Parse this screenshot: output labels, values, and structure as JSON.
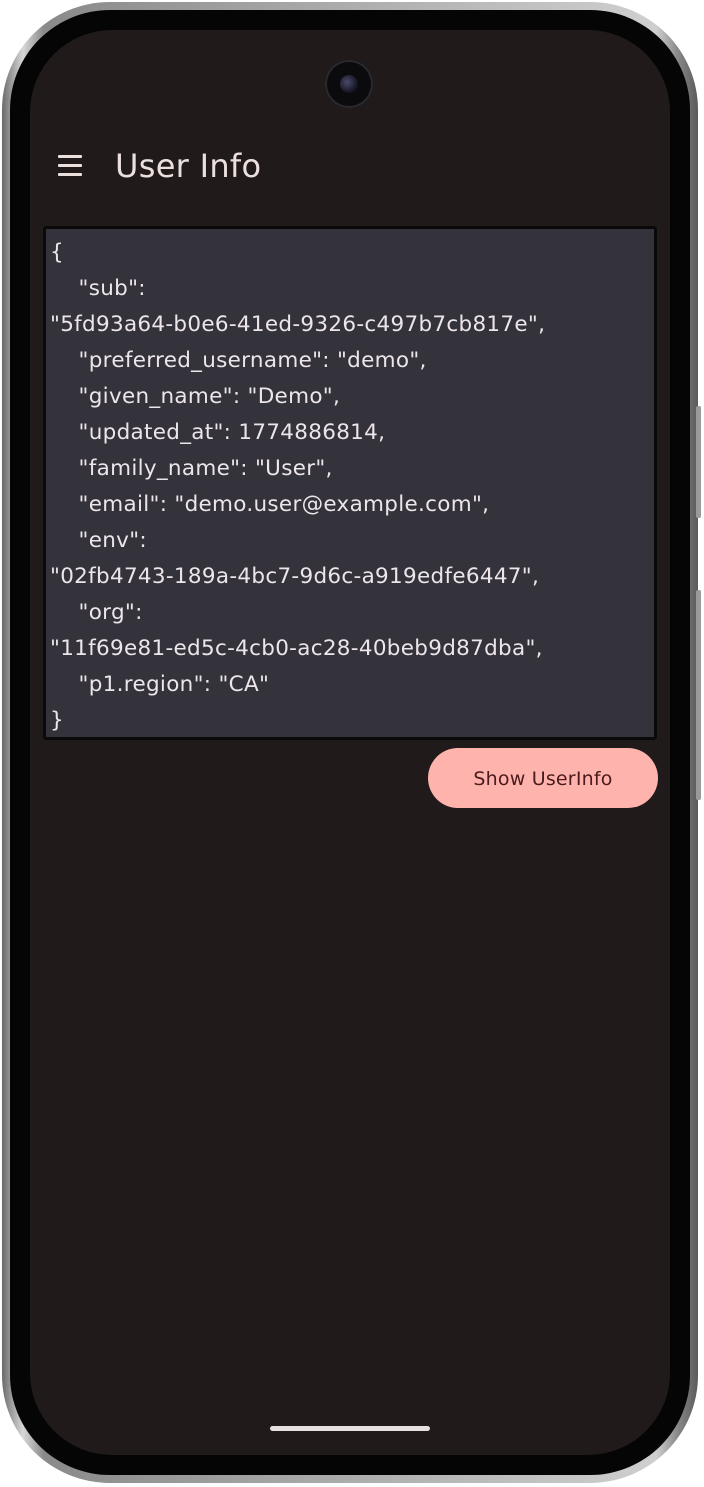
{
  "app_bar": {
    "menu_icon": "hamburger-menu-icon",
    "title": "User Info"
  },
  "userinfo_json": "{\n    \"sub\":\n\"5fd93a64-b0e6-41ed-9326-c497b7cb817e\",\n    \"preferred_username\": \"demo\",\n    \"given_name\": \"Demo\",\n    \"updated_at\": 1774886814,\n    \"family_name\": \"User\",\n    \"email\": \"demo.user@example.com\",\n    \"env\":\n\"02fb4743-189a-4bc7-9d6c-a919edfe6447\",\n    \"org\":\n\"11f69e81-ed5c-4cb0-ac28-40beb9d87dba\",\n    \"p1.region\": \"CA\"\n}",
  "actions": {
    "show_userinfo_label": "Show UserInfo"
  },
  "colors": {
    "background": "#201a1a",
    "json_box": "#34323b",
    "button": "#ffb3ad",
    "button_text": "#4a1a1c",
    "on_surface": "#ece0de"
  }
}
